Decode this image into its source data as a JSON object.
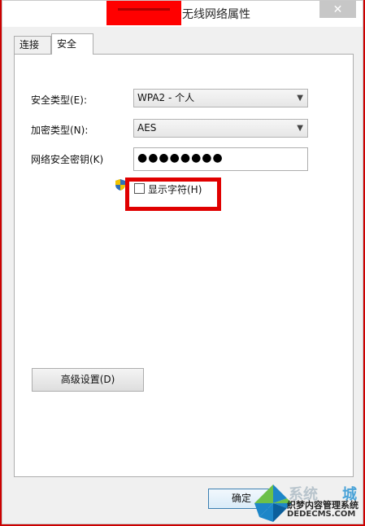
{
  "window": {
    "title": "无线网络属性",
    "close_label": "✕"
  },
  "tabs": [
    {
      "label": "连接"
    },
    {
      "label": "安全"
    }
  ],
  "security": {
    "type_label": "安全类型(E):",
    "type_value": "WPA2 - 个人",
    "encryption_label": "加密类型(N):",
    "encryption_value": "AES",
    "key_label": "网络安全密钥(K)",
    "key_value": "●●●●●●●●",
    "show_chars_label": "显示字符(H)"
  },
  "buttons": {
    "advanced": "高级设置(D)",
    "ok": "确定"
  },
  "watermark": {
    "line1": "织梦内容管理系统",
    "line2": "DEDECMS.COM",
    "faint": "系统",
    "faint2": "城"
  },
  "colors": {
    "highlight": "#e00000",
    "accent": "#3c7fb1"
  }
}
